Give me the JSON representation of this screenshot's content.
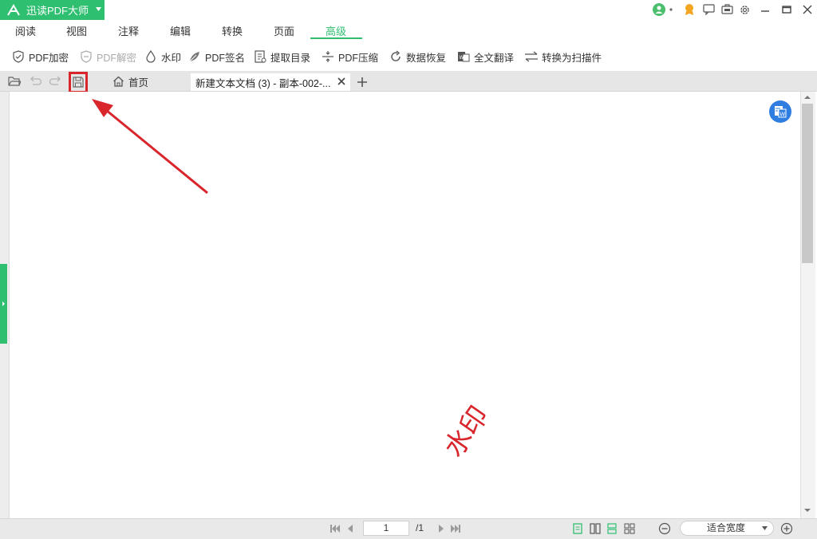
{
  "app": {
    "title": "迅读PDF大师"
  },
  "menu": {
    "tabs": [
      {
        "label": "阅读"
      },
      {
        "label": "视图"
      },
      {
        "label": "注释"
      },
      {
        "label": "编辑"
      },
      {
        "label": "转换"
      },
      {
        "label": "页面"
      },
      {
        "label": "高级",
        "active": true
      }
    ]
  },
  "toolbar": {
    "items": [
      {
        "label": "PDF加密",
        "icon": "shield-check-icon"
      },
      {
        "label": "PDF解密",
        "icon": "shield-minus-icon",
        "disabled": true
      },
      {
        "label": "水印",
        "icon": "droplet-icon"
      },
      {
        "label": "PDF签名",
        "icon": "feather-icon"
      },
      {
        "label": "提取目录",
        "icon": "list-doc-icon"
      },
      {
        "label": "PDF压缩",
        "icon": "compress-icon"
      },
      {
        "label": "数据恢复",
        "icon": "restore-icon"
      },
      {
        "label": "全文翻译",
        "icon": "translate-icon"
      },
      {
        "label": "转换为扫描件",
        "icon": "swap-icon"
      }
    ]
  },
  "tabs": {
    "home": "首页",
    "document": "新建文本文档 (3) - 副本-002-..."
  },
  "document": {
    "watermark_text": "水印"
  },
  "status": {
    "page_current": "1",
    "page_total": "/1",
    "zoom": "适合宽度"
  },
  "colors": {
    "brand": "#2fbf71",
    "highlight": "#d9262c",
    "convert_button": "#2f7de1"
  }
}
